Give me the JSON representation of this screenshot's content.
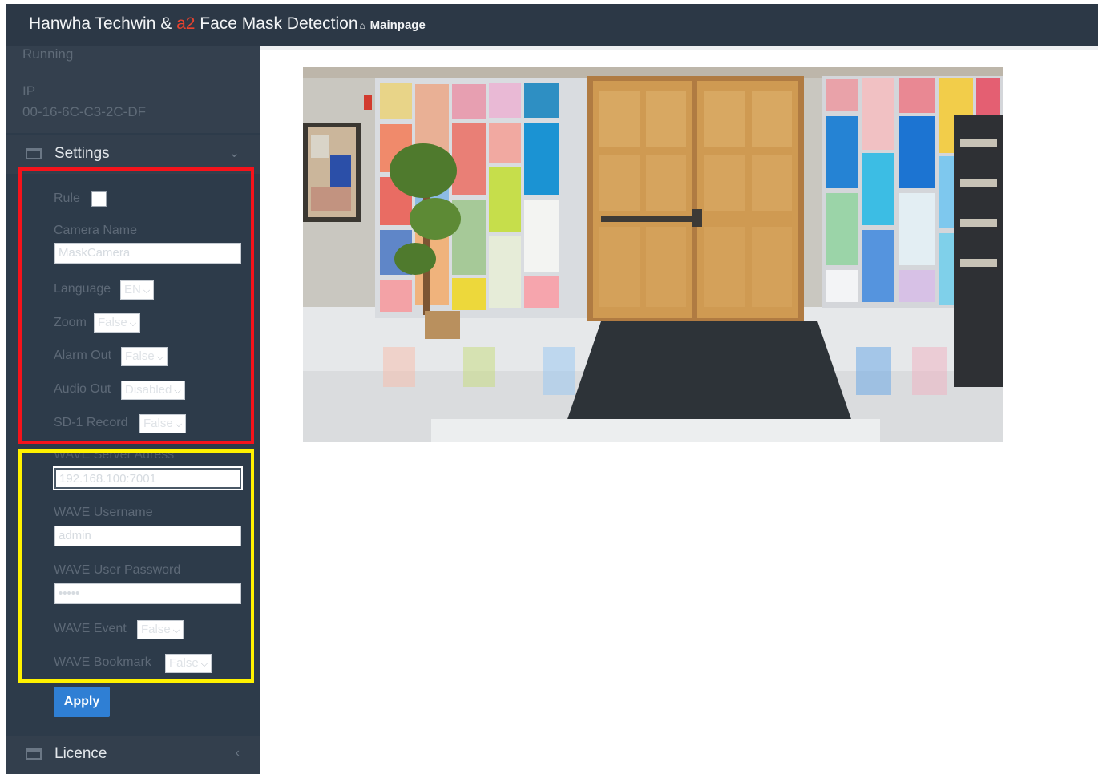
{
  "header": {
    "brand_prefix": "Hanwha Techwin & ",
    "brand_accent": "a2",
    "brand_suffix": " Face Mask Detection",
    "home_icon": "home-icon",
    "home_link": "Mainpage"
  },
  "status": {
    "running": "Running",
    "ip_label": "IP",
    "mac": "00-16-6C-C3-2C-DF"
  },
  "settings": {
    "title": "Settings",
    "rule_label": "Rule",
    "camera_name_label": "Camera Name",
    "camera_name_value": "MaskCamera",
    "language_label": "Language",
    "language_value": "EN",
    "zoom_label": "Zoom",
    "zoom_value": "False",
    "alarm_out_label": "Alarm Out",
    "alarm_out_value": "False",
    "audio_out_label": "Audio Out",
    "audio_out_value": "Disabled",
    "sd1_record_label": "SD-1 Record",
    "sd1_record_value": "False",
    "wave_server_label": "WAVE Server Adress",
    "wave_server_value": "192.168.100:7001",
    "wave_username_label": "WAVE Username",
    "wave_username_value": "admin",
    "wave_password_label": "WAVE User Password",
    "wave_password_value": "•••••",
    "wave_event_label": "WAVE Event",
    "wave_event_value": "False",
    "wave_bookmark_label": "WAVE Bookmark",
    "wave_bookmark_value": "False",
    "apply_label": "Apply"
  },
  "licence": {
    "title": "Licence"
  },
  "colors": {
    "topbar": "#2c3846",
    "sidebar": "#2d3b4a",
    "accent": "#e8432f",
    "apply": "#2f7fd4",
    "highlight_red": "#f5131b",
    "highlight_yellow": "#fff200"
  }
}
